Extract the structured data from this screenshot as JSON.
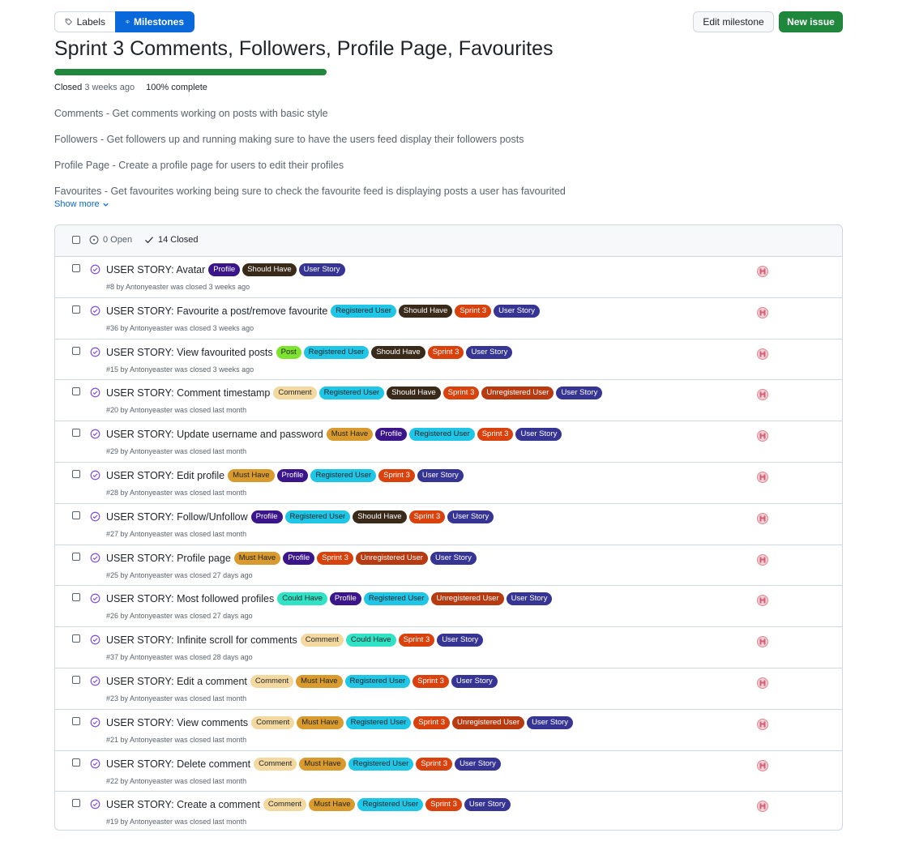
{
  "nav": {
    "labels": "Labels",
    "milestones": "Milestones",
    "edit_milestone": "Edit milestone",
    "new_issue": "New issue"
  },
  "milestone": {
    "title": "Sprint 3 Comments, Followers, Profile Page, Favourites",
    "progress_percent": 100,
    "status": "Closed",
    "closed_ago": "3 weeks ago",
    "complete": "100% complete",
    "description": [
      "Comments - Get comments working on posts with basic style",
      "Followers - Get followers up and running making sure to have the users feed display their followers posts",
      "Profile Page - Create a profile page for users to edit their profiles",
      "Favourites - Get favourites working being sure to check the favourite feed is displaying posts a user has favourited"
    ],
    "show_more": "Show more"
  },
  "list_header": {
    "open": "0 Open",
    "closed": "14 Closed"
  },
  "label_colors": {
    "Profile": {
      "bg": "#3b168a",
      "fg": "#ffffff"
    },
    "Should Have": {
      "bg": "#3a2a1a",
      "fg": "#ffffff"
    },
    "User Story": {
      "bg": "#373594",
      "fg": "#ffffff"
    },
    "Registered User": {
      "bg": "#1fc6e6",
      "fg": "#1f2328"
    },
    "Sprint 3": {
      "bg": "#d9410d",
      "fg": "#ffffff"
    },
    "Post": {
      "bg": "#7ee32f",
      "fg": "#1f2328"
    },
    "Comment": {
      "bg": "#f3d9a0",
      "fg": "#1f2328"
    },
    "Unregistered User": {
      "bg": "#b83a10",
      "fg": "#ffffff"
    },
    "Must Have": {
      "bg": "#d99a2e",
      "fg": "#1f2328"
    },
    "Could Have": {
      "bg": "#30e3c5",
      "fg": "#1f2328"
    }
  },
  "issues": [
    {
      "title": "USER STORY: Avatar",
      "labels": [
        "Profile",
        "Should Have",
        "User Story"
      ],
      "meta": "#8 by Antonyeaster was closed 3 weeks ago"
    },
    {
      "title": "USER STORY: Favourite a post/remove favourite",
      "labels": [
        "Registered User",
        "Should Have",
        "Sprint 3",
        "User Story"
      ],
      "meta": "#36 by Antonyeaster was closed 3 weeks ago"
    },
    {
      "title": "USER STORY: View favourited posts",
      "labels": [
        "Post",
        "Registered User",
        "Should Have",
        "Sprint 3",
        "User Story"
      ],
      "meta": "#15 by Antonyeaster was closed 3 weeks ago"
    },
    {
      "title": "USER STORY: Comment timestamp",
      "labels": [
        "Comment",
        "Registered User",
        "Should Have",
        "Sprint 3",
        "Unregistered User",
        "User Story"
      ],
      "meta": "#20 by Antonyeaster was closed last month"
    },
    {
      "title": "USER STORY: Update username and password",
      "labels": [
        "Must Have",
        "Profile",
        "Registered User",
        "Sprint 3",
        "User Story"
      ],
      "meta": "#29 by Antonyeaster was closed last month"
    },
    {
      "title": "USER STORY: Edit profile",
      "labels": [
        "Must Have",
        "Profile",
        "Registered User",
        "Sprint 3",
        "User Story"
      ],
      "meta": "#28 by Antonyeaster was closed last month"
    },
    {
      "title": "USER STORY: Follow/Unfollow",
      "labels": [
        "Profile",
        "Registered User",
        "Should Have",
        "Sprint 3",
        "User Story"
      ],
      "meta": "#27 by Antonyeaster was closed last month"
    },
    {
      "title": "USER STORY: Profile page",
      "labels": [
        "Must Have",
        "Profile",
        "Sprint 3",
        "Unregistered User",
        "User Story"
      ],
      "meta": "#25 by Antonyeaster was closed 27 days ago"
    },
    {
      "title": "USER STORY: Most followed profiles",
      "labels": [
        "Could Have",
        "Profile",
        "Registered User",
        "Unregistered User",
        "User Story"
      ],
      "meta": "#26 by Antonyeaster was closed 27 days ago"
    },
    {
      "title": "USER STORY: Infinite scroll for comments",
      "labels": [
        "Comment",
        "Could Have",
        "Sprint 3",
        "User Story"
      ],
      "meta": "#37 by Antonyeaster was closed 28 days ago"
    },
    {
      "title": "USER STORY: Edit a comment",
      "labels": [
        "Comment",
        "Must Have",
        "Registered User",
        "Sprint 3",
        "User Story"
      ],
      "meta": "#23 by Antonyeaster was closed last month"
    },
    {
      "title": "USER STORY: View comments",
      "labels": [
        "Comment",
        "Must Have",
        "Registered User",
        "Sprint 3",
        "Unregistered User",
        "User Story"
      ],
      "meta": "#21 by Antonyeaster was closed last month"
    },
    {
      "title": "USER STORY: Delete comment",
      "labels": [
        "Comment",
        "Must Have",
        "Registered User",
        "Sprint 3",
        "User Story"
      ],
      "meta": "#22 by Antonyeaster was closed last month"
    },
    {
      "title": "USER STORY: Create a comment",
      "labels": [
        "Comment",
        "Must Have",
        "Registered User",
        "Sprint 3",
        "User Story"
      ],
      "meta": "#19 by Antonyeaster was closed last month"
    }
  ]
}
